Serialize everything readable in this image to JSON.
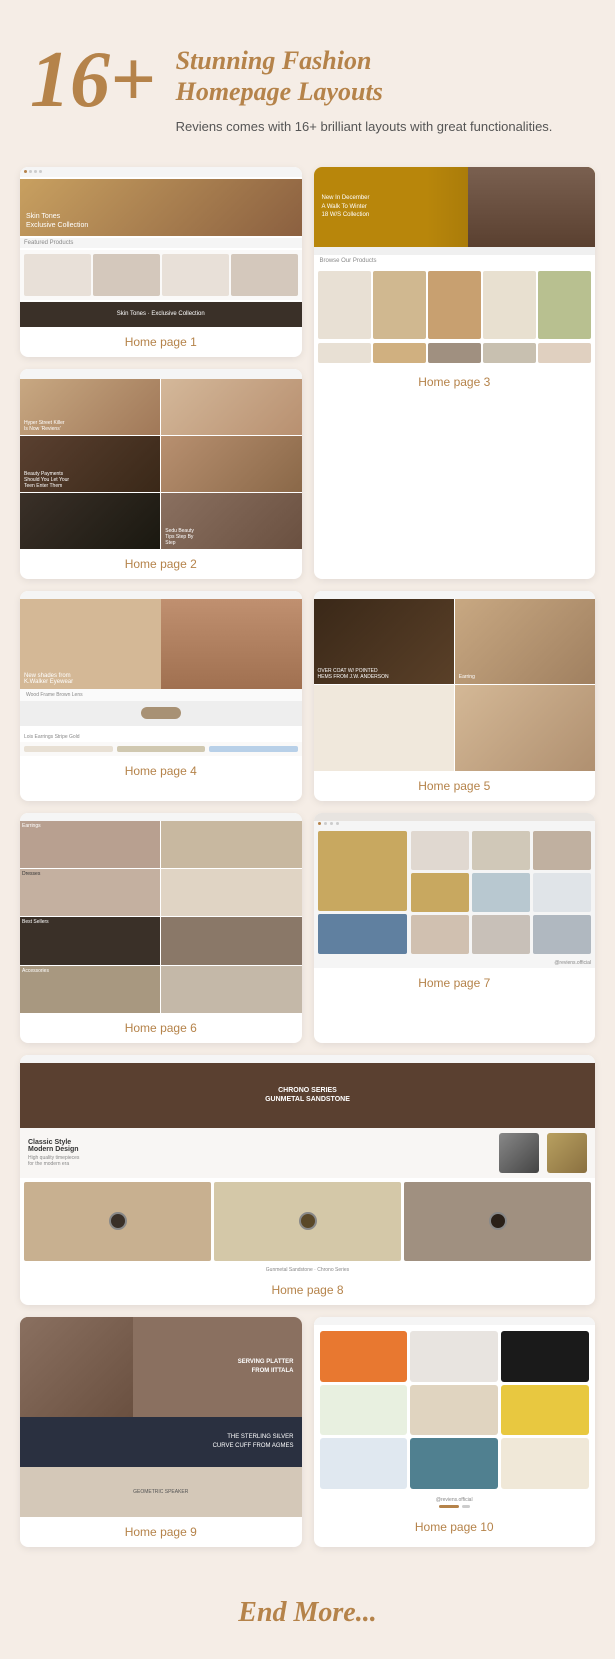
{
  "header": {
    "number": "16+",
    "title_line1": "Stunning Fashion",
    "title_line2": "Homepage Layouts",
    "description": "Reviens comes with 16+ brilliant layouts with great functionalities."
  },
  "pages": [
    {
      "id": 1,
      "label": "Home page 1",
      "hero_text": "Skin Tones\nExclusive Collection",
      "featured": "Featured Products"
    },
    {
      "id": 2,
      "label": "Home page 2",
      "texts": [
        "Hyper Street Killer\nIs Now 'Reviens'",
        "Beauty Payments Should You\nLet Your Teen Enter Them",
        "Sedu Beauty\nTips Step By\nStep"
      ]
    },
    {
      "id": 3,
      "label": "Home page 3",
      "hero_text": "New In December\nA Walk To Winter\n18 W/S Collection",
      "section": "Browse Our Products"
    },
    {
      "id": 4,
      "label": "Home page 4",
      "hero_text": "New shades from\nK.Walker Eyewear",
      "sub_text": "Wood Frame Brown Lens"
    },
    {
      "id": 5,
      "label": "Home page 5",
      "hero_text": "OVER COAT W/ POINTED HEMS\nFROM J.W. ANDERSON",
      "sub_label": "Earring"
    },
    {
      "id": 6,
      "label": "Home page 6",
      "categories": [
        "Earrings",
        "Dresses",
        "Best Sellers",
        "Accessories"
      ]
    },
    {
      "id": 7,
      "label": "Home page 7",
      "note": "@reviens.official"
    },
    {
      "id": 8,
      "label": "Home page 8",
      "hero_text": "CHRONO SERIES\nGUNMETAL SANDSTONE",
      "section": "Classic Style\nModern Design",
      "sub": "Gunmetal Sandstone\nChrono Series"
    },
    {
      "id": 9,
      "label": "Home page 9",
      "texts": [
        "SERVING PLATTER\nFROM IITTALA",
        "THE STERLING SILVER\nCURVE CUFF FROM AGMES",
        "GEOMETRIC SPEAKER"
      ]
    },
    {
      "id": 10,
      "label": "Home page 10",
      "note": "@reviens.official"
    }
  ],
  "footer": {
    "label": "End More..."
  }
}
